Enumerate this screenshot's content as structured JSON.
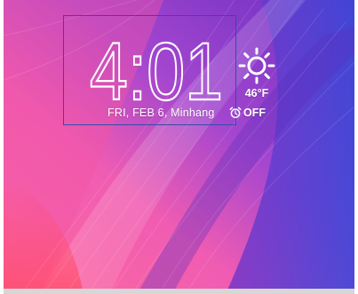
{
  "lockscreen": {
    "time": "4:01",
    "date_location": "FRI, FEB 6, Minhang",
    "alarm": {
      "icon": "alarm-clock-icon",
      "status": "OFF"
    },
    "weather": {
      "icon": "sun-icon",
      "temperature": "46°F"
    }
  },
  "colors": {
    "accent_frame": "#2d4fa8",
    "text": "#ffffff"
  }
}
